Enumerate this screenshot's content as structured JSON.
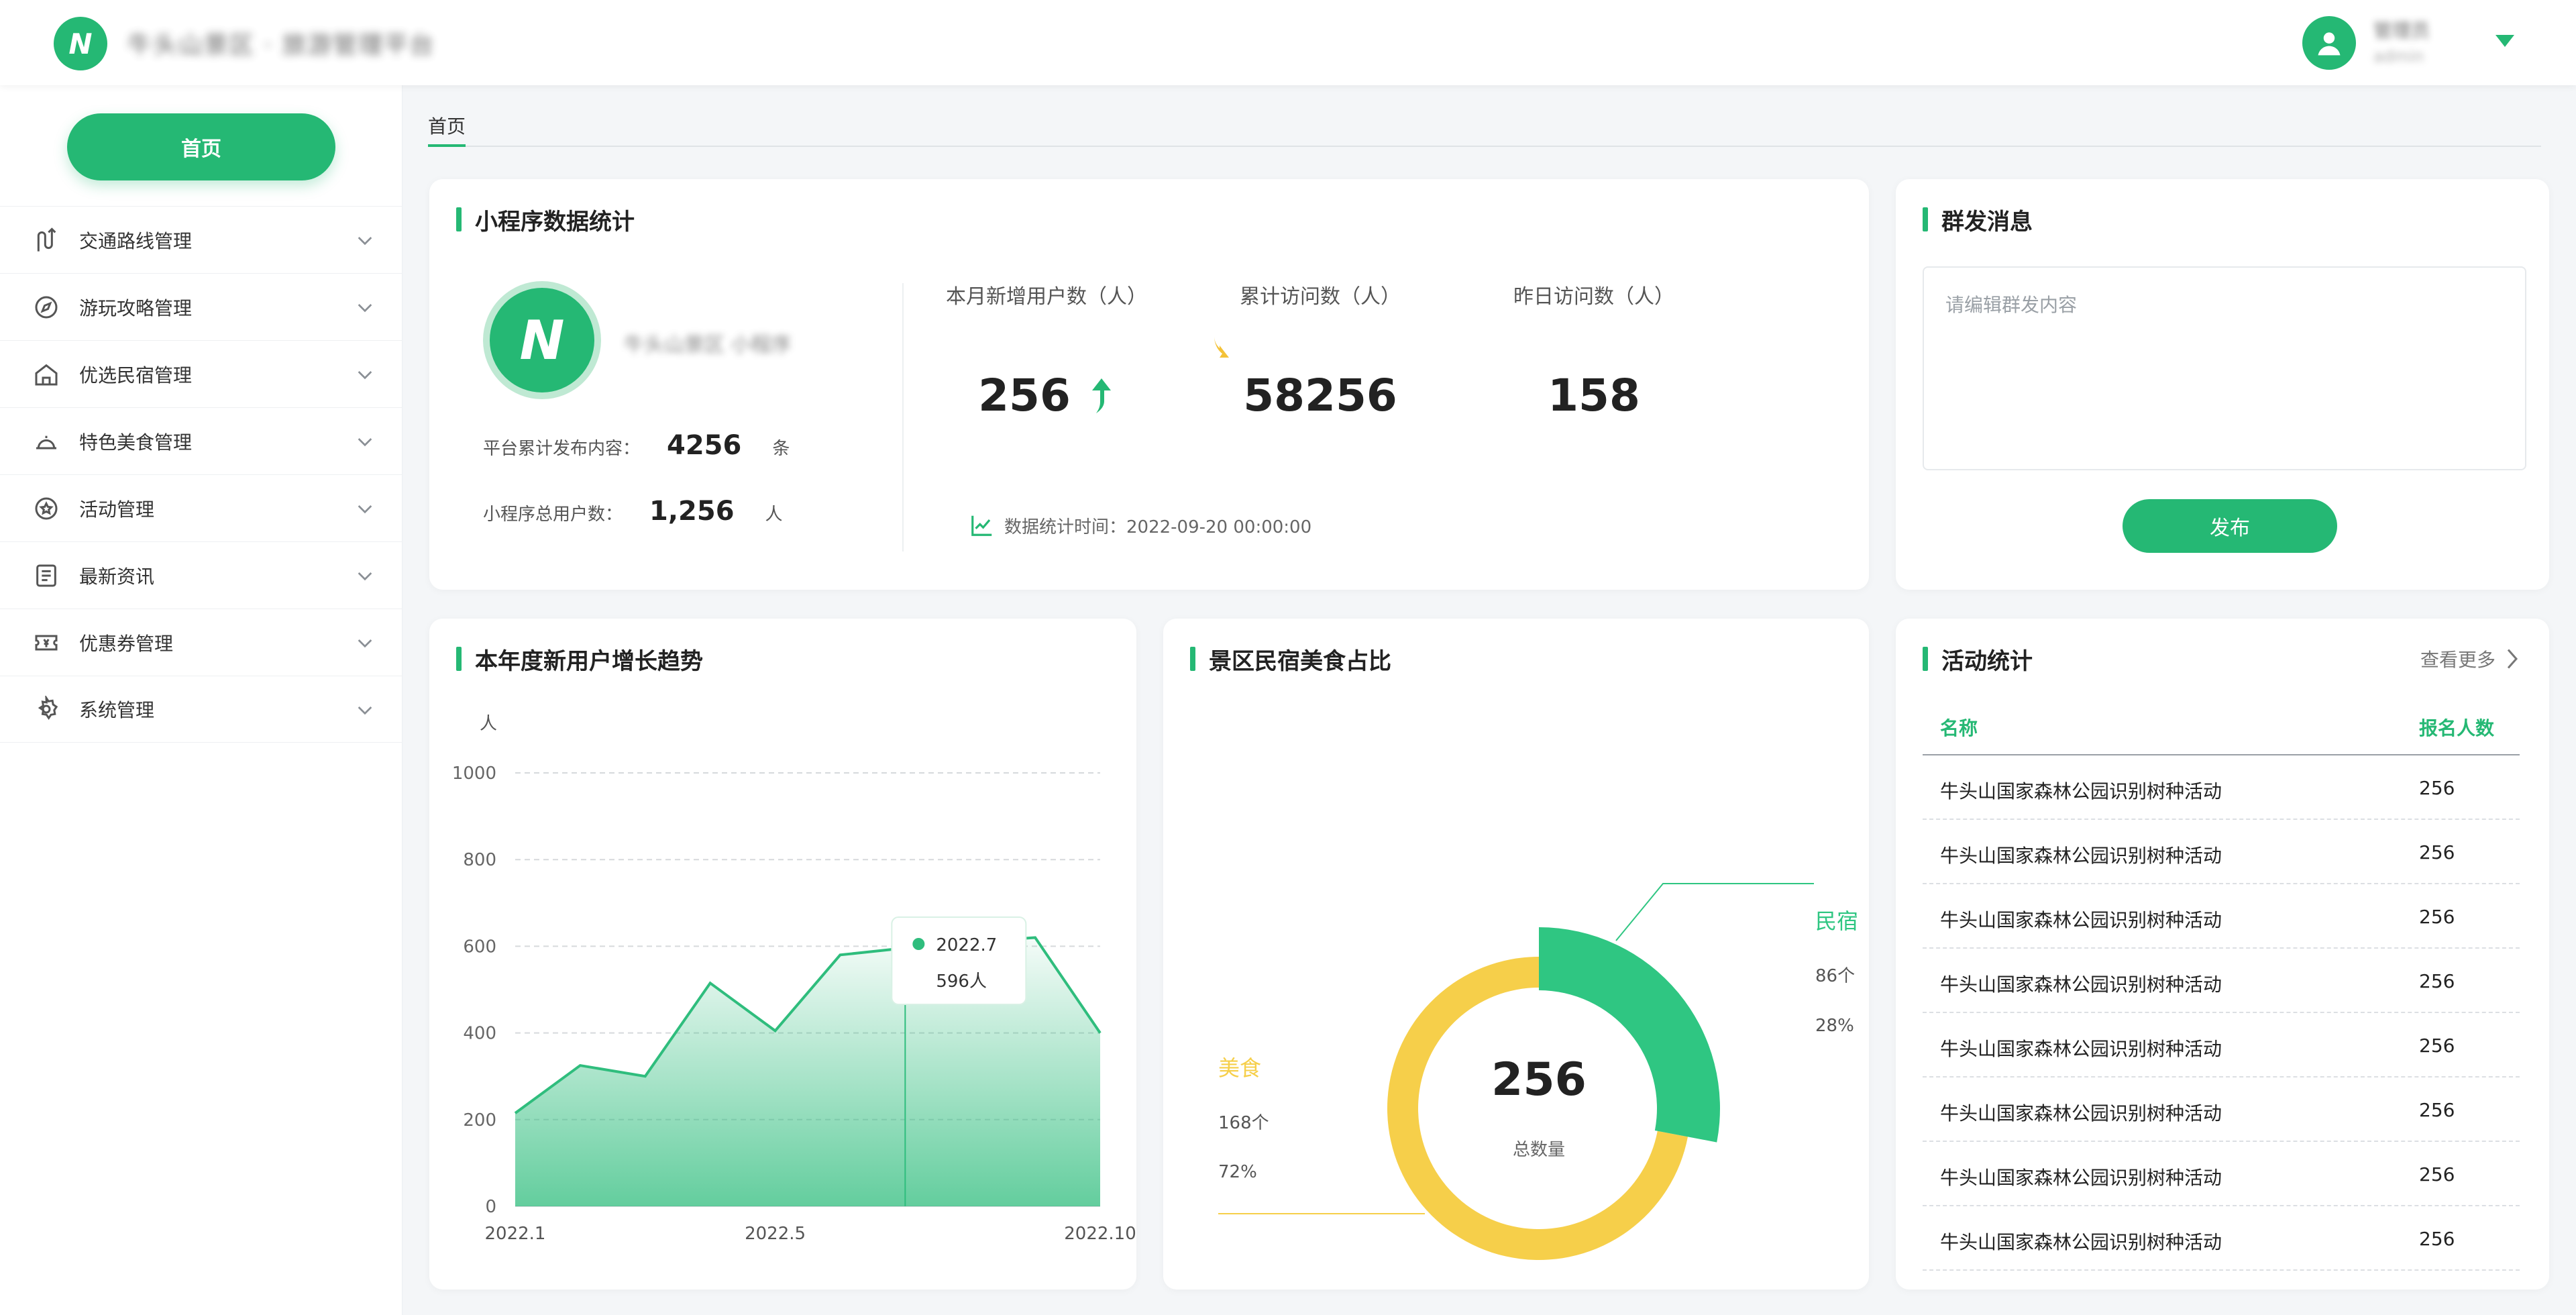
{
  "header": {
    "logo_text": "N",
    "app_title": "牛头山景区 · 旅游管理平台",
    "user": {
      "name": "管理员",
      "sub": "admin"
    }
  },
  "sidebar": {
    "home_label": "首页",
    "items": [
      {
        "label": "交通路线管理",
        "icon": "route-icon"
      },
      {
        "label": "游玩攻略管理",
        "icon": "compass-icon"
      },
      {
        "label": "优选民宿管理",
        "icon": "house-icon"
      },
      {
        "label": "特色美食管理",
        "icon": "food-cloche-icon"
      },
      {
        "label": "活动管理",
        "icon": "star-badge-icon"
      },
      {
        "label": "最新资讯",
        "icon": "news-icon"
      },
      {
        "label": "优惠券管理",
        "icon": "coupon-icon"
      },
      {
        "label": "系统管理",
        "icon": "gear-icon"
      }
    ]
  },
  "tabs": {
    "active": "首页"
  },
  "stats": {
    "title": "小程序数据统计",
    "logo_text": "N",
    "miniapp_name": "牛头山景区 小程序",
    "published": {
      "label": "平台累计发布内容：",
      "value": "4256",
      "unit": "条"
    },
    "total_users": {
      "label": "小程序总用户数：",
      "value": "1,256",
      "unit": "人"
    },
    "metrics": [
      {
        "label": "本月新增用户数（人）",
        "value": "256",
        "trend": "up"
      },
      {
        "label": "累计访问数（人）",
        "value": "58256"
      },
      {
        "label": "昨日访问数（人）",
        "value": "158"
      }
    ],
    "time_label": "数据统计时间：2022-09-20 00:00:00"
  },
  "broadcast": {
    "title": "群发消息",
    "placeholder": "请编辑群发内容",
    "button_label": "发布"
  },
  "growth_chart": {
    "title": "本年度新用户增长趋势"
  },
  "chart_data": [
    {
      "type": "area",
      "title": "本年度新用户增长趋势",
      "ylabel": "人",
      "xlabel": "",
      "x_ticks": [
        "2022.1",
        "2022.5",
        "2022.10"
      ],
      "y_ticks": [
        "0",
        "200",
        "400",
        "600",
        "800",
        "1000"
      ],
      "ylim": [
        0,
        1000
      ],
      "x": [
        "2022.1",
        "2022.2",
        "2022.3",
        "2022.4",
        "2022.5",
        "2022.6",
        "2022.7",
        "2022.8",
        "2022.9",
        "2022.10"
      ],
      "values": [
        215,
        325,
        300,
        515,
        405,
        580,
        596,
        610,
        620,
        400
      ],
      "tooltip": {
        "x": "2022.7",
        "label": "596人"
      },
      "series_color": "#2fbd7d",
      "grid": true
    },
    {
      "type": "pie",
      "title": "景区民宿美食占比",
      "center_value": "256",
      "center_label": "总数量",
      "slices": [
        {
          "name": "民宿",
          "count": 86,
          "count_label": "86个",
          "percent": 28,
          "percent_label": "28%",
          "color": "#2fc682"
        },
        {
          "name": "美食",
          "count": 168,
          "count_label": "168个",
          "percent": 72,
          "percent_label": "72%",
          "color": "#f6cf4a"
        }
      ]
    }
  ],
  "donut_chart": {
    "title": "景区民宿美食占比"
  },
  "activity": {
    "title": "活动统计",
    "more_label": "查看更多",
    "columns": [
      "名称",
      "报名人数"
    ],
    "rows": [
      {
        "name": "牛头山国家森林公园识别树种活动",
        "count": "256"
      },
      {
        "name": "牛头山国家森林公园识别树种活动",
        "count": "256"
      },
      {
        "name": "牛头山国家森林公园识别树种活动",
        "count": "256"
      },
      {
        "name": "牛头山国家森林公园识别树种活动",
        "count": "256"
      },
      {
        "name": "牛头山国家森林公园识别树种活动",
        "count": "256"
      },
      {
        "name": "牛头山国家森林公园识别树种活动",
        "count": "256"
      },
      {
        "name": "牛头山国家森林公园识别树种活动",
        "count": "256"
      },
      {
        "name": "牛头山国家森林公园识别树种活动",
        "count": "256"
      }
    ]
  },
  "colors": {
    "primary": "#25b874",
    "accent_yellow": "#f6cf4a",
    "background": "#f4f6f8"
  }
}
